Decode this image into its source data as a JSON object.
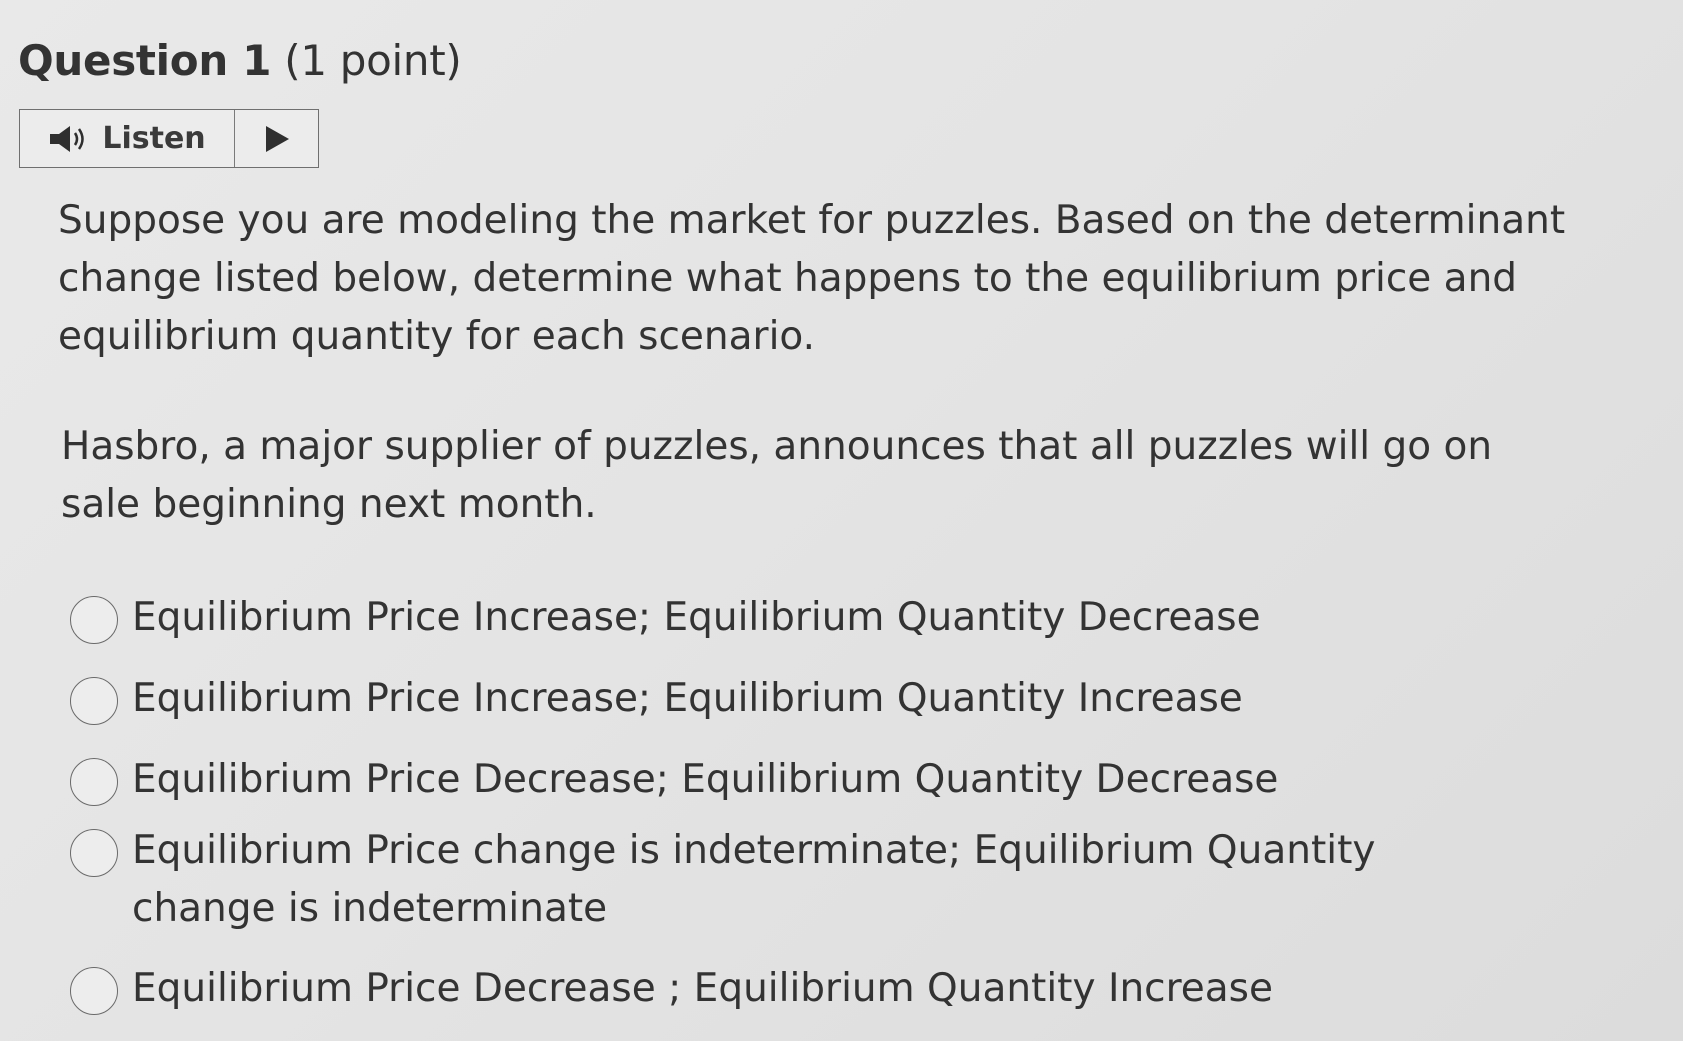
{
  "question": {
    "number_label": "Question 1",
    "points_label": "(1 point)"
  },
  "listen_widget": {
    "label": "Listen",
    "speaker_icon": "speaker-icon",
    "play_icon": "play-icon"
  },
  "prompt": "Suppose you are modeling the market for puzzles. Based on the determinant change listed below, determine what happens to the equilibrium price and equilibrium quantity for each scenario.",
  "scenario": "Hasbro, a major supplier of puzzles, announces that all puzzles will go on sale beginning next month.",
  "options": [
    {
      "label": "Equilibrium Price Increase; Equilibrium Quantity Decrease",
      "selected": false
    },
    {
      "label": "Equilibrium Price Increase; Equilibrium Quantity Increase",
      "selected": false
    },
    {
      "label": "Equilibrium Price Decrease; Equilibrium Quantity Decrease",
      "selected": false
    },
    {
      "label": "Equilibrium Price change is indeterminate; Equilibrium Quantity change is indeterminate",
      "selected": false
    },
    {
      "label": "Equilibrium Price Decrease ; Equilibrium Quantity Increase",
      "selected": false
    }
  ]
}
